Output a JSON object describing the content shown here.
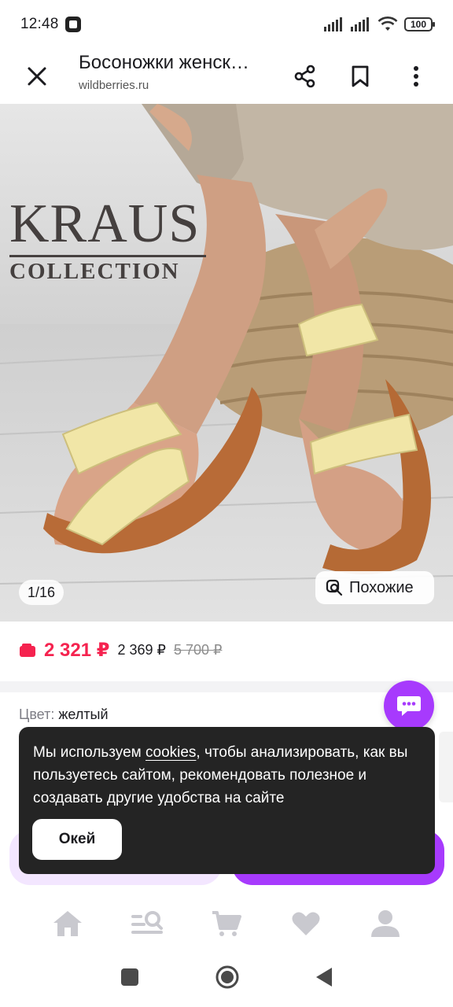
{
  "status_bar": {
    "time": "12:48",
    "battery": "100"
  },
  "top_bar": {
    "title": "Босоножки женск…",
    "domain": "wildberries.ru"
  },
  "product_image": {
    "brand_name": "KRAUS",
    "brand_sub": "COLLECTION",
    "counter": "1/16",
    "similar_label": "Похожие"
  },
  "price": {
    "current": "2 321 ₽",
    "alt": "2 369 ₽",
    "old": "5 700 ₽",
    "accent_color": "#f5234f"
  },
  "color": {
    "label": "Цвет:",
    "value": "желтый"
  },
  "cookie_banner": {
    "text_before": "Мы используем ",
    "link": "cookies",
    "text_after": ", чтобы анализировать, как вы пользуетесь сайтом, рекомендовать полезное и создавать другие удобства на сайте",
    "ok_label": "Окей"
  },
  "bottom_nav": {
    "items": [
      {
        "icon": "home-icon"
      },
      {
        "icon": "catalog-search-icon"
      },
      {
        "icon": "cart-icon"
      },
      {
        "icon": "favorites-icon"
      },
      {
        "icon": "profile-icon"
      }
    ],
    "icon_color": "#c9c9cf"
  },
  "brand_color": "#a73afd"
}
